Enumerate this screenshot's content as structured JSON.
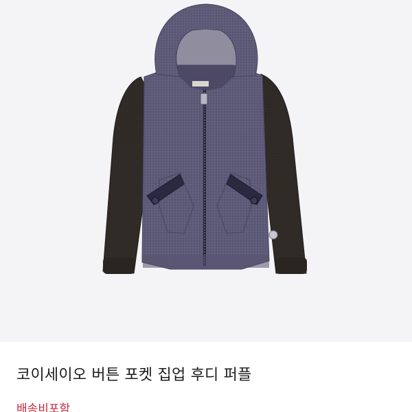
{
  "product": {
    "title": "코이세이오 버튼 포켓 집업 후디 퍼플",
    "shipping_label": "배송비포함",
    "image_icon": "hoodie-photo"
  },
  "colors": {
    "image_background": "#f4f3f6",
    "body_fabric": "#5d5a78",
    "sleeve": "#2f2a26",
    "pocket_trim": "#2b2840",
    "shipping_text": "#c8283c",
    "title_text": "#1c1c1c"
  }
}
